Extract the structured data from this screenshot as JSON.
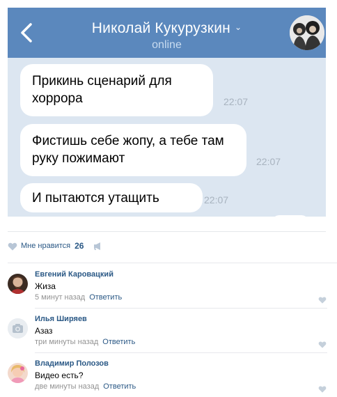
{
  "chat": {
    "contact_name": "Николай Кукурузкин",
    "status": "online",
    "messages": [
      {
        "text": "Прикинь сценарий для хоррора",
        "time": "22:07"
      },
      {
        "text": "Фистишь себе жопу, а тебе там руку пожимают",
        "time": "22:07"
      },
      {
        "text": "И пытаются утащить",
        "time": "22:07"
      }
    ]
  },
  "likes": {
    "label": "Мне нравится",
    "count": "26"
  },
  "comments": [
    {
      "author": "Евгений Каровацкий",
      "text": "Жиза",
      "time": "5 минут назад",
      "reply": "Ответить"
    },
    {
      "author": "Илья Ширяев",
      "text": "Азаз",
      "time": "три минуты назад",
      "reply": "Ответить"
    },
    {
      "author": "Владимир Полозов",
      "text": "Видео есть?",
      "time": "две минуты назад",
      "reply": "Ответить"
    }
  ],
  "colors": {
    "header_blue": "#5b88bd",
    "chat_background": "#dce6f1",
    "link_blue": "#2a5885"
  },
  "icons": [
    "back-arrow-icon",
    "chevron-down-icon",
    "heart-icon",
    "megaphone-icon",
    "camera-icon"
  ]
}
